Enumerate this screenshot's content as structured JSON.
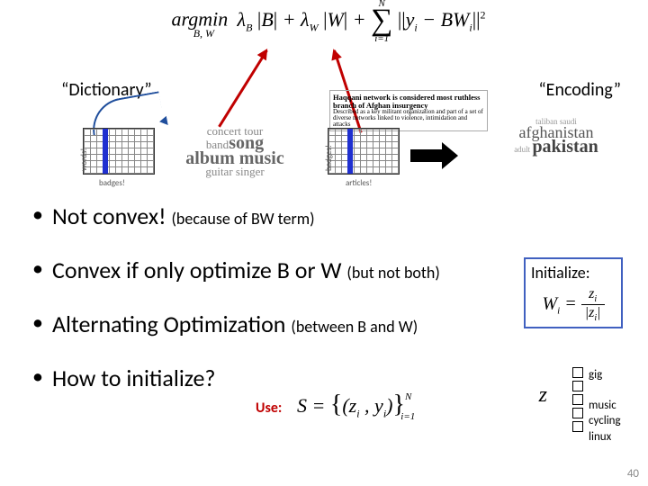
{
  "formula": {
    "main": "argmin λ_B |B| + λ_W |W| + Σ ||y_i − BW_i||²",
    "argmin_sub": "B, W",
    "sum_top": "N",
    "sum_bot": "i=1"
  },
  "labels": {
    "dictionary": "“Dictionary”",
    "encoding": "“Encoding”"
  },
  "axes": {
    "b_vert": "words!",
    "b_horiz": "badges!",
    "b2_vert": "badges!",
    "b2_horiz": "articles!"
  },
  "wordcloud1": {
    "line1": "concert tour",
    "big1": "song",
    "line2": "band",
    "big2": "album music",
    "line3": "guitar singer"
  },
  "news": {
    "headline": "Haqqani network is considered most ruthless branch of Afghan insurgency",
    "body": "Described as a key militant organization and part of a set of diverse networks linked to violence, intimidation and attacks"
  },
  "wordcloud2": {
    "line1": "taliban saudi",
    "big1": "afghanistan",
    "line2": "adult",
    "big2": "pakistan"
  },
  "bullets": {
    "b1_main": "Not convex!",
    "b1_sub": "(because of BW term)",
    "b2_main": "Convex if only optimize B or W",
    "b2_sub": "(but not both)",
    "b3_main": "Alternating Optimization",
    "b3_sub": "(between B and W)",
    "b4_main": "How to initialize?"
  },
  "initialize": {
    "title": "Initialize:",
    "lhs": "W_i =",
    "num": "z_i",
    "den": "|z_i|"
  },
  "use": {
    "label": "Use:",
    "formula": "S = {(z_i, y_i)}",
    "sub": "i=1",
    "sup": "N",
    "zvar": "z"
  },
  "zlabels": [
    "gig",
    "music",
    "cycling",
    "linux"
  ],
  "page": "40"
}
